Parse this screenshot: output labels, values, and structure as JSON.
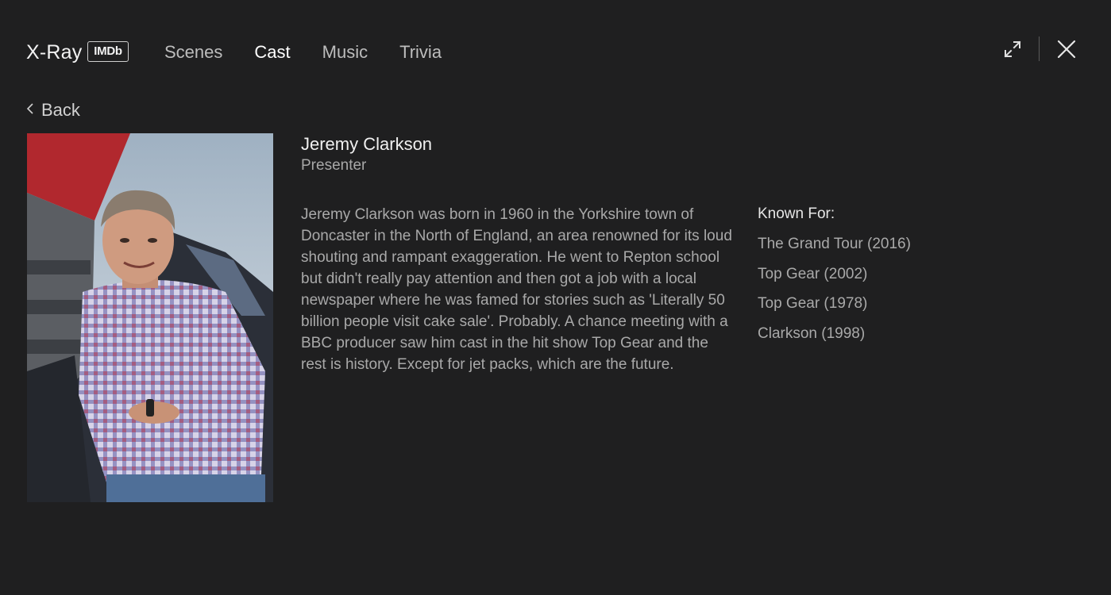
{
  "header": {
    "brand": "X-Ray",
    "badge": "IMDb",
    "tabs": [
      {
        "label": "Scenes",
        "active": false
      },
      {
        "label": "Cast",
        "active": true
      },
      {
        "label": "Music",
        "active": false
      },
      {
        "label": "Trivia",
        "active": false
      }
    ]
  },
  "nav": {
    "back_label": "Back"
  },
  "person": {
    "name": "Jeremy Clarkson",
    "role": "Presenter",
    "bio": "Jeremy Clarkson was born in 1960 in the Yorkshire town of Doncaster in the North of England, an area renowned for its loud shouting and rampant exaggeration. He went to Repton school but didn't really pay attention and then got a job with a local newspaper where he was famed for stories such as 'Literally 50 billion people visit cake sale'. Probably. A chance meeting with a BBC producer saw him cast in the hit show Top Gear and the rest is history. Except for jet packs, which are the future."
  },
  "known_for": {
    "title": "Known For:",
    "items": [
      "The Grand Tour (2016)",
      "Top Gear (2002)",
      "Top Gear (1978)",
      "Clarkson (1998)"
    ]
  },
  "icons": {
    "expand": "expand-icon",
    "close": "close-icon",
    "back": "chevron-left-icon"
  },
  "colors": {
    "background": "#1f1f20",
    "text_primary": "#f0f0f0",
    "text_secondary": "#a9a9a9",
    "tab_inactive": "#bdbdbd"
  }
}
